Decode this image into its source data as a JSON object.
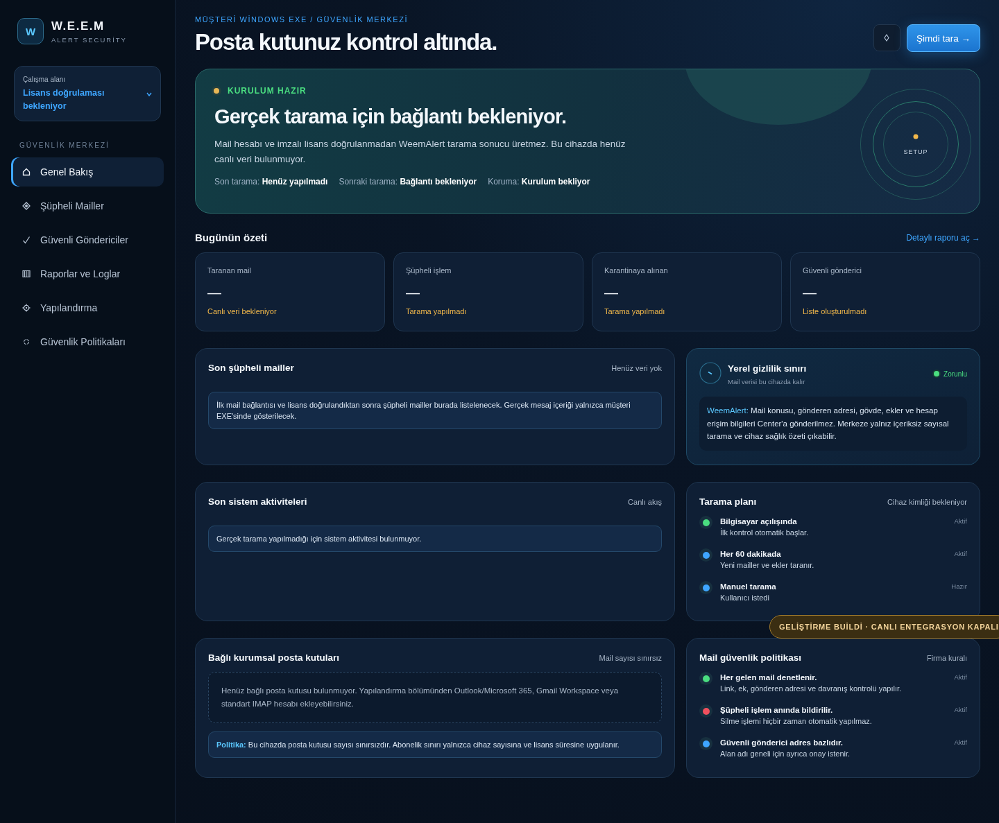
{
  "brand": {
    "logo_letter": "W",
    "name": "W.E.E.M",
    "tagline": "ALERT SECURİTY"
  },
  "workspace": {
    "label": "Çalışma alanı",
    "value": "Lisans doğrulaması bekleniyor"
  },
  "nav_section": "GÜVENLİK MERKEZİ",
  "nav": [
    {
      "label": "Genel Bakış",
      "selected": true
    },
    {
      "label": "Şüpheli Mailler",
      "selected": false
    },
    {
      "label": "Güvenli Göndericiler",
      "selected": false
    },
    {
      "label": "Raporlar ve Loglar",
      "selected": false
    },
    {
      "label": "Yapılandırma",
      "selected": false
    },
    {
      "label": "Güvenlik Politikaları",
      "selected": false
    }
  ],
  "header": {
    "breadcrumb": "MÜŞTERİ WİNDOWS EXE / GÜVENLİK MERKEZİ",
    "title": "Posta kutunuz kontrol altında.",
    "scan_button": "Şimdi tara →"
  },
  "hero": {
    "status": "KURULUM HAZIR",
    "title": "Gerçek tarama için bağlantı bekleniyor.",
    "text": "Mail hesabı ve imzalı lisans doğrulanmadan WeemAlert tarama sonucu üretmez. Bu cihazda henüz canlı veri bulunmuyor.",
    "meta": [
      "Son tarama: **Henüz yapılmadı**",
      "Sonraki tarama: **Bağlantı bekleniyor**",
      "Koruma: **Kurulum bekliyor**"
    ],
    "ring_label": "SETUP"
  },
  "summary": {
    "title": "Bugünün özeti",
    "link": "Detaylı raporu aç →",
    "cards": [
      {
        "label": "Taranan mail",
        "value": "—",
        "note": "Canlı veri bekleniyor"
      },
      {
        "label": "Şüpheli işlem",
        "value": "—",
        "note": "Tarama yapılmadı"
      },
      {
        "label": "Karantinaya alınan",
        "value": "—",
        "note": "Tarama yapılmadı"
      },
      {
        "label": "Güvenli gönderici",
        "value": "—",
        "note": "Liste oluşturulmadı"
      }
    ]
  },
  "suspicious": {
    "title": "Son şüpheli mailler",
    "meta": "Henüz veri yok",
    "note": "İlk mail bağlantısı ve lisans doğrulandıktan sonra şüpheli mailler burada listelenecek. Gerçek mesaj içeriği yalnızca müşteri EXE'sinde gösterilecek."
  },
  "privacy": {
    "title": "Yerel gizlilik sınırı",
    "subtitle": "Mail verisi bu cihazda kalır",
    "badge": "Zorunlu",
    "lead": "WeemAlert:",
    "text": "Mail konusu, gönderen adresi, gövde, ekler ve hesap erişim bilgileri Center'a gönderilmez. Merkeze yalnız içeriksiz sayısal tarama ve cihaz sağlık özeti çıkabilir."
  },
  "activity": {
    "title": "Son sistem aktiviteleri",
    "meta": "Canlı akış",
    "note": "Gerçek tarama yapılmadığı için sistem aktivitesi bulunmuyor."
  },
  "schedule": {
    "title": "Tarama planı",
    "meta": "Cihaz kimliği bekleniyor",
    "items": [
      {
        "title": "Bilgisayar açılışında",
        "text": "İlk kontrol otomatik başlar.",
        "status": "Aktif",
        "color": "#4ade80"
      },
      {
        "title": "Her 60 dakikada",
        "text": "Yeni mailler ve ekler taranır.",
        "status": "Aktif",
        "color": "#3ea6ff"
      },
      {
        "title": "Manuel tarama",
        "text": "Kullanıcı istedi",
        "status": "Hazır",
        "color": "#3ea6ff"
      }
    ]
  },
  "mailboxes": {
    "title": "Bağlı kurumsal posta kutuları",
    "meta": "Mail sayısı sınırsız",
    "empty": "Henüz bağlı posta kutusu bulunmuyor. Yapılandırma bölümünden Outlook/Microsoft 365, Gmail Workspace veya standart IMAP hesabı ekleyebilirsiniz.",
    "policy_lead": "Politika:",
    "policy_text": "Bu cihazda posta kutusu sayısı sınırsızdır. Abonelik sınırı yalnızca cihaz sayısına ve lisans süresine uygulanır."
  },
  "policy": {
    "title": "Mail güvenlik politikası",
    "meta": "Firma kuralı",
    "items": [
      {
        "title": "Her gelen mail denetlenir.",
        "text": "Link, ek, gönderen adresi ve davranış kontrolü yapılır.",
        "status": "Aktif",
        "color": "#4ade80"
      },
      {
        "title": "Şüpheli işlem anında bildirilir.",
        "text": "Silme işlemi hiçbir zaman otomatik yapılmaz.",
        "status": "Aktif",
        "color": "#f0505e"
      },
      {
        "title": "Güvenli gönderici adres bazlıdır.",
        "text": "Alan adı geneli için ayrıca onay istenir.",
        "status": "Aktif",
        "color": "#3ea6ff"
      }
    ]
  },
  "dev_badge": "GELİŞTİRME BUİLDİ · CANLI ENTEGRASYON KAPALI"
}
